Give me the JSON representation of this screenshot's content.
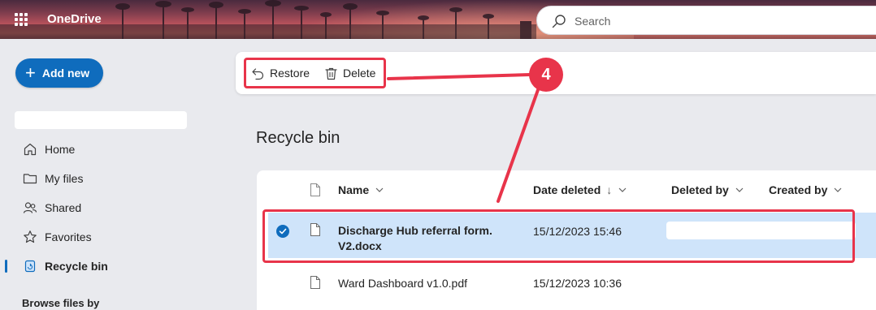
{
  "header": {
    "app_name": "OneDrive",
    "search_placeholder": "Search"
  },
  "sidebar": {
    "add_new_label": "Add new",
    "items": [
      {
        "label": "Home",
        "icon": "home-icon"
      },
      {
        "label": "My files",
        "icon": "folder-icon"
      },
      {
        "label": "Shared",
        "icon": "people-icon"
      },
      {
        "label": "Favorites",
        "icon": "star-icon"
      },
      {
        "label": "Recycle bin",
        "icon": "recycle-bin-icon",
        "active": true
      }
    ],
    "browse_label": "Browse files by"
  },
  "command_bar": {
    "restore_label": "Restore",
    "delete_label": "Delete"
  },
  "annotation": {
    "step_number": "4",
    "color": "#e8344a"
  },
  "main": {
    "title": "Recycle bin",
    "columns": [
      "Name",
      "Date deleted",
      "Deleted by",
      "Created by"
    ],
    "sort_indicator": "↓",
    "rows": [
      {
        "name": "Discharge Hub referral form. V2.docx",
        "date_deleted": "15/12/2023 15:46",
        "selected": true
      },
      {
        "name": "Ward Dashboard v1.0.pdf",
        "date_deleted": "15/12/2023 10:36",
        "selected": false
      }
    ]
  },
  "colors": {
    "accent": "#0f6cbd",
    "selected_row": "#cfe4fa",
    "annotation": "#e8344a"
  }
}
